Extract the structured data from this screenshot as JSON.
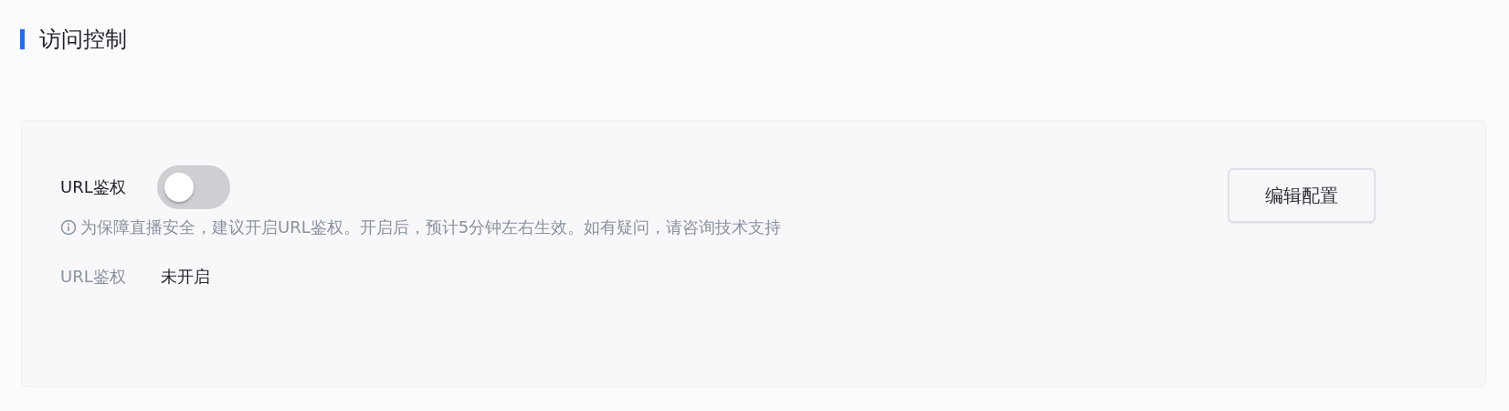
{
  "section": {
    "title": "访问控制"
  },
  "card": {
    "toggle": {
      "label": "URL鉴权",
      "on": false
    },
    "hint": "为保障直播安全，建议开启URL鉴权。开启后，预计5分钟左右生效。如有疑问，请咨询技术支持",
    "details": [
      {
        "label": "URL鉴权",
        "value": "未开启"
      }
    ],
    "button": "编辑配置"
  }
}
